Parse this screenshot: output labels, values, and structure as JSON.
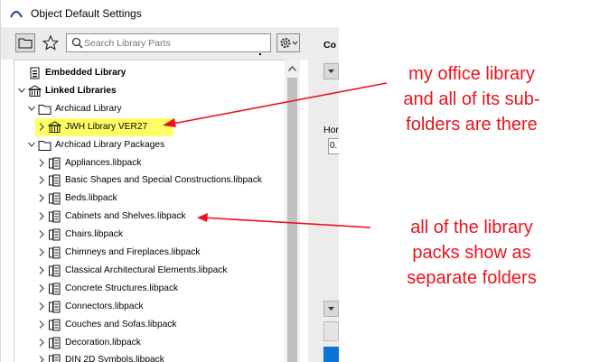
{
  "window": {
    "title": "Object Default Settings"
  },
  "toolbar": {
    "search_placeholder": "Search Library Parts"
  },
  "tree": {
    "rows": [
      {
        "label": "Embedded Library"
      },
      {
        "label": "Linked Libraries"
      },
      {
        "label": "Archicad Library"
      },
      {
        "label": "JWH Library VER27"
      },
      {
        "label": "Archicad Library Packages"
      },
      {
        "label": "Appliances.libpack"
      },
      {
        "label": "Basic Shapes and Special Constructions.libpack"
      },
      {
        "label": "Beds.libpack"
      },
      {
        "label": "Cabinets and Shelves.libpack"
      },
      {
        "label": "Chairs.libpack"
      },
      {
        "label": "Chimneys and Fireplaces.libpack"
      },
      {
        "label": "Classical Architectural Elements.libpack"
      },
      {
        "label": "Concrete Structures.libpack"
      },
      {
        "label": "Connectors.libpack"
      },
      {
        "label": "Couches and Sofas.libpack"
      },
      {
        "label": "Decoration.libpack"
      },
      {
        "label": "DIN 2D Symbols.libpack"
      }
    ]
  },
  "right_panel": {
    "heading": "Co",
    "field_label": "Hor",
    "field_value": "0."
  },
  "annotations": {
    "note1": [
      "my office library",
      "and all of its sub-",
      "folders are there"
    ],
    "note2": [
      "all of the library",
      "packs show as",
      "separate folders"
    ],
    "highlight_color": "#ffff66",
    "annotation_color": "#e8131d"
  }
}
